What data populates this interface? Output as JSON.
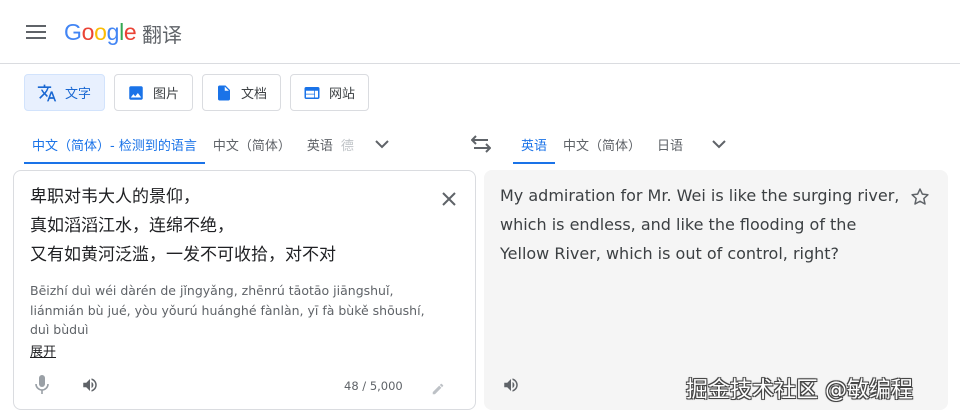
{
  "header": {
    "logo": [
      "G",
      "o",
      "o",
      "g",
      "l",
      "e"
    ],
    "product": "翻译"
  },
  "modes": [
    {
      "label": "文字",
      "icon": "translate-icon"
    },
    {
      "label": "图片",
      "icon": "image-icon"
    },
    {
      "label": "文档",
      "icon": "document-icon"
    },
    {
      "label": "网站",
      "icon": "website-icon"
    }
  ],
  "source_langs": {
    "detected": "中文（简体）- 检测到的语言",
    "option1": "中文（简体）",
    "option2": "英语",
    "faded": "德"
  },
  "target_langs": {
    "active": "英语",
    "option1": "中文（简体）",
    "option2": "日语"
  },
  "source": {
    "lines": [
      "卑职对韦大人的景仰，",
      "真如滔滔江水，连绵不绝，",
      "又有如黄河泛滥，一发不可收拾，对不对"
    ],
    "romanization": [
      "Bēizhí duì wéi dàrén de jǐngyǎng, zhēnrú tāotāo jiāngshuǐ,",
      "liánmián bù jué, yòu yǒurú huánghé fànlàn, yī fà bùkě shōushí,",
      "duì bùduì"
    ],
    "expand": "展开",
    "char_count": "48 / 5,000"
  },
  "target": {
    "lines": [
      "My admiration for Mr. Wei is like the surging river,",
      "which is endless, and like the flooding of the",
      "Yellow River, which is out of control, right?"
    ]
  },
  "watermark": "掘金技术社区 @敏编程",
  "colors": {
    "accent": "#1a73e8",
    "active_bg": "#e8f0fe",
    "target_bg": "#f5f5f5"
  }
}
